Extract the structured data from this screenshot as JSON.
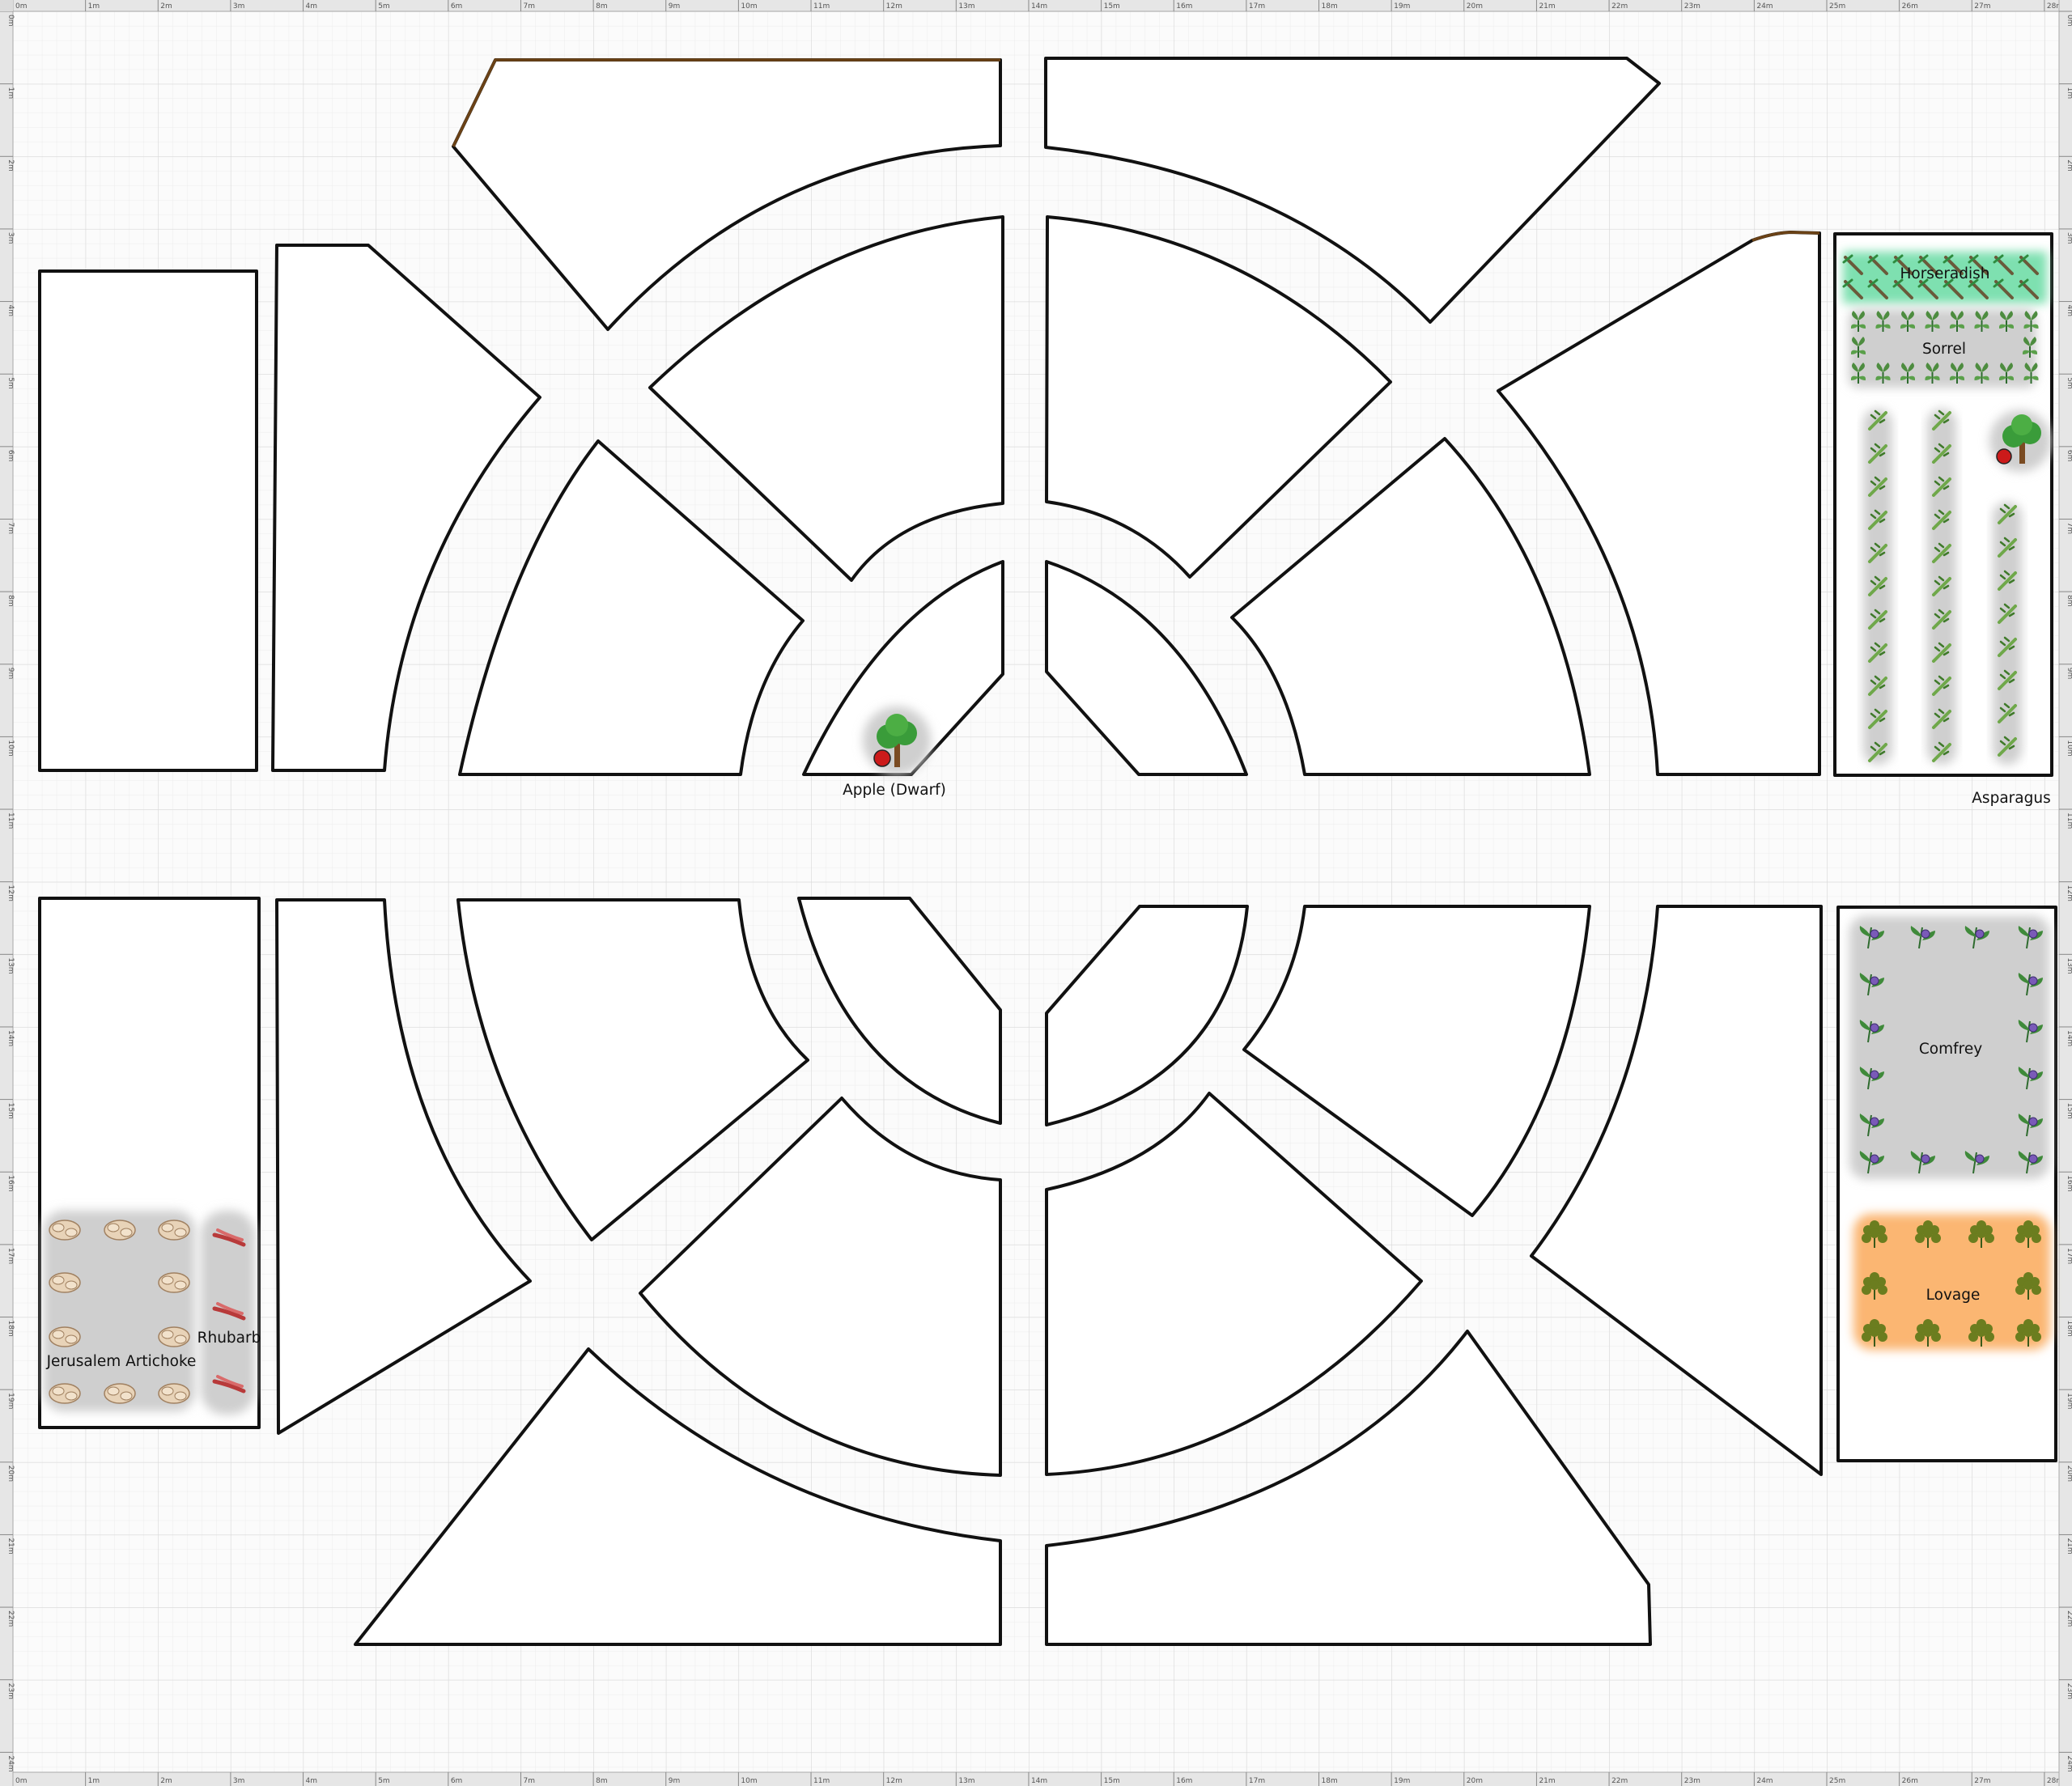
{
  "ruler": {
    "x_ticks": [
      "0m",
      "1m",
      "2m",
      "3m",
      "4m",
      "5m",
      "6m",
      "7m",
      "8m",
      "9m",
      "10m",
      "11m",
      "12m",
      "13m",
      "14m",
      "15m",
      "16m",
      "17m",
      "18m",
      "19m",
      "20m",
      "21m",
      "22m",
      "23m",
      "24m",
      "25m",
      "26m",
      "27m",
      "28m"
    ],
    "y_ticks": [
      "0m",
      "1m",
      "2m",
      "3m",
      "4m",
      "5m",
      "6m",
      "7m",
      "8m",
      "9m",
      "10m",
      "11m",
      "12m",
      "13m",
      "14m",
      "15m",
      "16m",
      "17m",
      "18m",
      "19m",
      "20m",
      "21m",
      "22m",
      "23m",
      "24m"
    ]
  },
  "plants": [
    {
      "id": "apple-top",
      "label": "Apple (Dwarf)",
      "icon": "apple-tree-icon"
    },
    {
      "id": "apple-right",
      "label": "",
      "icon": "apple-tree-icon"
    },
    {
      "id": "horseradish",
      "label": "Horseradish",
      "icon": "horseradish-icon",
      "color": "#7ee0b0"
    },
    {
      "id": "sorrel",
      "label": "Sorrel",
      "icon": "sorrel-icon"
    },
    {
      "id": "asparagus",
      "label": "Asparagus",
      "icon": "asparagus-icon"
    },
    {
      "id": "comfrey",
      "label": "Comfrey",
      "icon": "comfrey-icon"
    },
    {
      "id": "lovage",
      "label": "Lovage",
      "icon": "lovage-icon",
      "color": "#fbb672"
    },
    {
      "id": "jerusalem-artichoke",
      "label": "Jerusalem Artichoke",
      "icon": "jerusalem-artichoke-icon"
    },
    {
      "id": "rhubarb",
      "label": "Rhubarb",
      "icon": "rhubarb-icon"
    }
  ],
  "colors": {
    "bed_outline": "#111111",
    "edging": "#6b4216",
    "plant_area": "#cfcfcf",
    "grid_minor": "#ececec",
    "grid_major": "#d9d9d9"
  }
}
